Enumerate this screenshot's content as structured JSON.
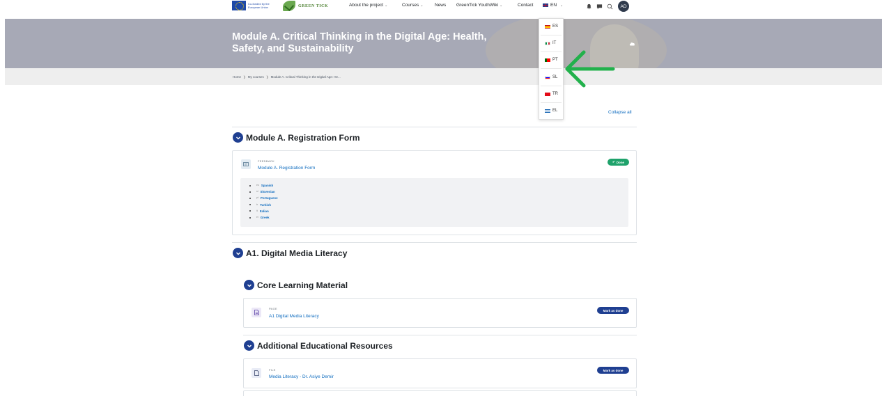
{
  "navbar": {
    "eu_text": "Co-funded by the European Union",
    "brand": "GREEN TICK",
    "menu": [
      {
        "label": "About the project",
        "has_caret": true
      },
      {
        "label": "Courses",
        "has_caret": true
      },
      {
        "label": "News",
        "has_caret": false
      },
      {
        "label": "GreenTick YouthWiki",
        "has_caret": true
      },
      {
        "label": "Contact",
        "has_caret": false
      }
    ],
    "current_language": "EN",
    "avatar_initials": "AD",
    "icons": [
      "bell-icon",
      "chat-icon",
      "search-icon"
    ]
  },
  "hero": {
    "title": "Module A. Critical Thinking in the Digital Age: Health, Safety, and Sustainability"
  },
  "breadcrumb": [
    "Home",
    "My courses",
    "Module A. Critical Thinking in the Digital Age: He..."
  ],
  "language_dropdown": {
    "options": [
      {
        "code": "ES",
        "flag": "flag-es"
      },
      {
        "code": "IT",
        "flag": "flag-it"
      },
      {
        "code": "PT",
        "flag": "flag-pt"
      },
      {
        "code": "SL",
        "flag": "flag-sl"
      },
      {
        "code": "TR",
        "flag": "flag-tr"
      },
      {
        "code": "EL",
        "flag": "flag-el"
      }
    ]
  },
  "course": {
    "collapse_all": "Collapse all",
    "sections": [
      {
        "title": "Module A. Registration Form",
        "activity": {
          "type": "FEEDBACK",
          "name": "Module A. Registration Form",
          "status": "Done"
        },
        "languages": [
          {
            "code": "es",
            "name": "Spanish"
          },
          {
            "code": "sl",
            "name": "Slovenian"
          },
          {
            "code": "pt",
            "name": "Portuguese"
          },
          {
            "code": "tr",
            "name": "Turkish"
          },
          {
            "code": "it",
            "name": "Italian"
          },
          {
            "code": "el",
            "name": "Greek"
          }
        ]
      },
      {
        "title": "A1. Digital Media Literacy",
        "subsections": [
          {
            "title": "Core Learning Material",
            "activity": {
              "type": "PAGE",
              "name": "A1 Digital Media Literacy",
              "button": "Mark as done"
            }
          },
          {
            "title": "Additional Educational Resources",
            "activity": {
              "type": "FILE",
              "name": "Media Literacy - Dr. Asiye Demir",
              "button": "Mark as done"
            }
          }
        ]
      }
    ]
  },
  "colors": {
    "primary": "#1f3f91",
    "link": "#0f6cbf",
    "success": "#1fa26b",
    "hero_bg": "#a7a9b6",
    "arrow": "#22b14c"
  }
}
